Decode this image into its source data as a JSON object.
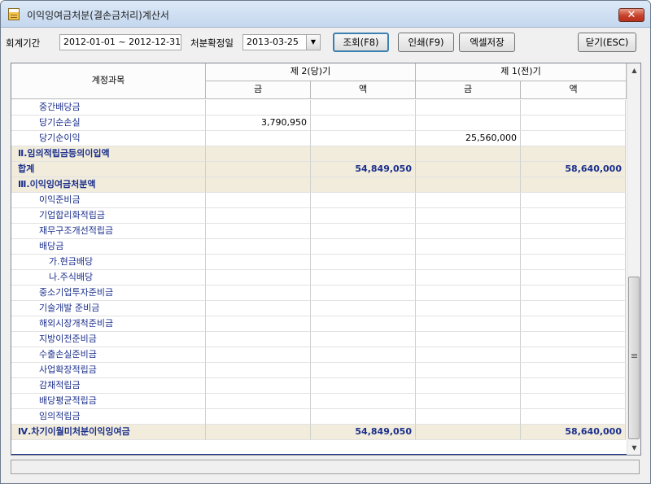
{
  "window": {
    "title": "이익잉여금처분(결손금처리)계산서",
    "close_label": "✕"
  },
  "toolbar": {
    "period_label": "회계기간",
    "period_value": "2012-01-01 ~ 2012-12-31",
    "date_label": "처분확정일",
    "date_value": "2013-03-25",
    "query_button": "조회(F8)",
    "print_button": "인쇄(F9)",
    "excel_button": "엑셀저장",
    "close_button": "닫기(ESC)"
  },
  "grid": {
    "headers": {
      "account": "계정과목",
      "current_period": "제 2(당)기",
      "prior_period": "제 1(전)기",
      "sub_amount_left": "금",
      "sub_amount_right": "액",
      "sub_amount_left2": "금",
      "sub_amount_right2": "액"
    },
    "rows": [
      {
        "account": "중간배당금",
        "c1": "",
        "c2": "",
        "c3": "",
        "c4": "",
        "style": "indent1"
      },
      {
        "account": "당기순손실",
        "c1": "3,790,950",
        "c2": "",
        "c3": "",
        "c4": "",
        "style": "indent1"
      },
      {
        "account": "당기순이익",
        "c1": "",
        "c2": "",
        "c3": "25,560,000",
        "c4": "",
        "style": "indent1"
      },
      {
        "account": "Ⅱ.임의적립금등의이입액",
        "c1": "",
        "c2": "",
        "c3": "",
        "c4": "",
        "style": "hl"
      },
      {
        "account": "합계",
        "c1": "",
        "c2": "54,849,050",
        "c3": "",
        "c4": "58,640,000",
        "style": "hl bold"
      },
      {
        "account": "Ⅲ.이익잉여금처분액",
        "c1": "",
        "c2": "",
        "c3": "",
        "c4": "",
        "style": "hl"
      },
      {
        "account": "이익준비금",
        "c1": "",
        "c2": "",
        "c3": "",
        "c4": "",
        "style": "indent1"
      },
      {
        "account": "기업합리화적립금",
        "c1": "",
        "c2": "",
        "c3": "",
        "c4": "",
        "style": "indent1"
      },
      {
        "account": "재무구조개선적립금",
        "c1": "",
        "c2": "",
        "c3": "",
        "c4": "",
        "style": "indent1"
      },
      {
        "account": "배당금",
        "c1": "",
        "c2": "",
        "c3": "",
        "c4": "",
        "style": "indent1"
      },
      {
        "account": "가.현금배당",
        "c1": "",
        "c2": "",
        "c3": "",
        "c4": "",
        "style": "indent2"
      },
      {
        "account": "나.주식배당",
        "c1": "",
        "c2": "",
        "c3": "",
        "c4": "",
        "style": "indent2"
      },
      {
        "account": "중소기업투자준비금",
        "c1": "",
        "c2": "",
        "c3": "",
        "c4": "",
        "style": "indent1"
      },
      {
        "account": "기술개발 준비금",
        "c1": "",
        "c2": "",
        "c3": "",
        "c4": "",
        "style": "indent1"
      },
      {
        "account": "해외시장개척준비금",
        "c1": "",
        "c2": "",
        "c3": "",
        "c4": "",
        "style": "indent1"
      },
      {
        "account": "지방이전준비금",
        "c1": "",
        "c2": "",
        "c3": "",
        "c4": "",
        "style": "indent1"
      },
      {
        "account": "수출손실준비금",
        "c1": "",
        "c2": "",
        "c3": "",
        "c4": "",
        "style": "indent1"
      },
      {
        "account": "사업확장적립금",
        "c1": "",
        "c2": "",
        "c3": "",
        "c4": "",
        "style": "indent1"
      },
      {
        "account": "감채적립금",
        "c1": "",
        "c2": "",
        "c3": "",
        "c4": "",
        "style": "indent1"
      },
      {
        "account": "배당평균적립금",
        "c1": "",
        "c2": "",
        "c3": "",
        "c4": "",
        "style": "indent1"
      },
      {
        "account": "임의적립금",
        "c1": "",
        "c2": "",
        "c3": "",
        "c4": "",
        "style": "indent1"
      },
      {
        "account": "Ⅳ.차기이월미처분이익잉여금",
        "c1": "",
        "c2": "54,849,050",
        "c3": "",
        "c4": "58,640,000",
        "style": "hl bold"
      }
    ]
  },
  "scrollbar": {
    "up_icon": "▲",
    "down_icon": "▼"
  }
}
